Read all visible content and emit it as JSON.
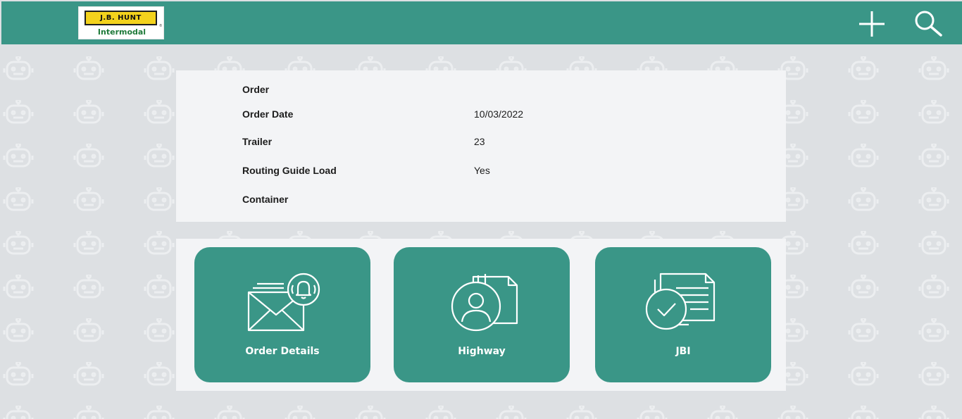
{
  "header": {
    "logo": {
      "brand_text": "J.B. HUNT",
      "sub_text": "Intermodal",
      "registered_mark": "®"
    },
    "accent_color": "#3a9687",
    "actions": [
      {
        "icon": "plus-icon"
      },
      {
        "icon": "search-icon"
      }
    ]
  },
  "order_info": {
    "fields": [
      {
        "label": "Order",
        "value": ""
      },
      {
        "label": "Order Date",
        "value": "10/03/2022"
      },
      {
        "label": "Trailer",
        "value": "23"
      },
      {
        "label": "Routing Guide Load",
        "value": "Yes"
      },
      {
        "label": "Container",
        "value": ""
      }
    ]
  },
  "cards": [
    {
      "label": "Order Details",
      "icon": "mail-bell-icon"
    },
    {
      "label": "Highway",
      "icon": "user-document-icon"
    },
    {
      "label": "JBI",
      "icon": "document-check-icon"
    }
  ]
}
